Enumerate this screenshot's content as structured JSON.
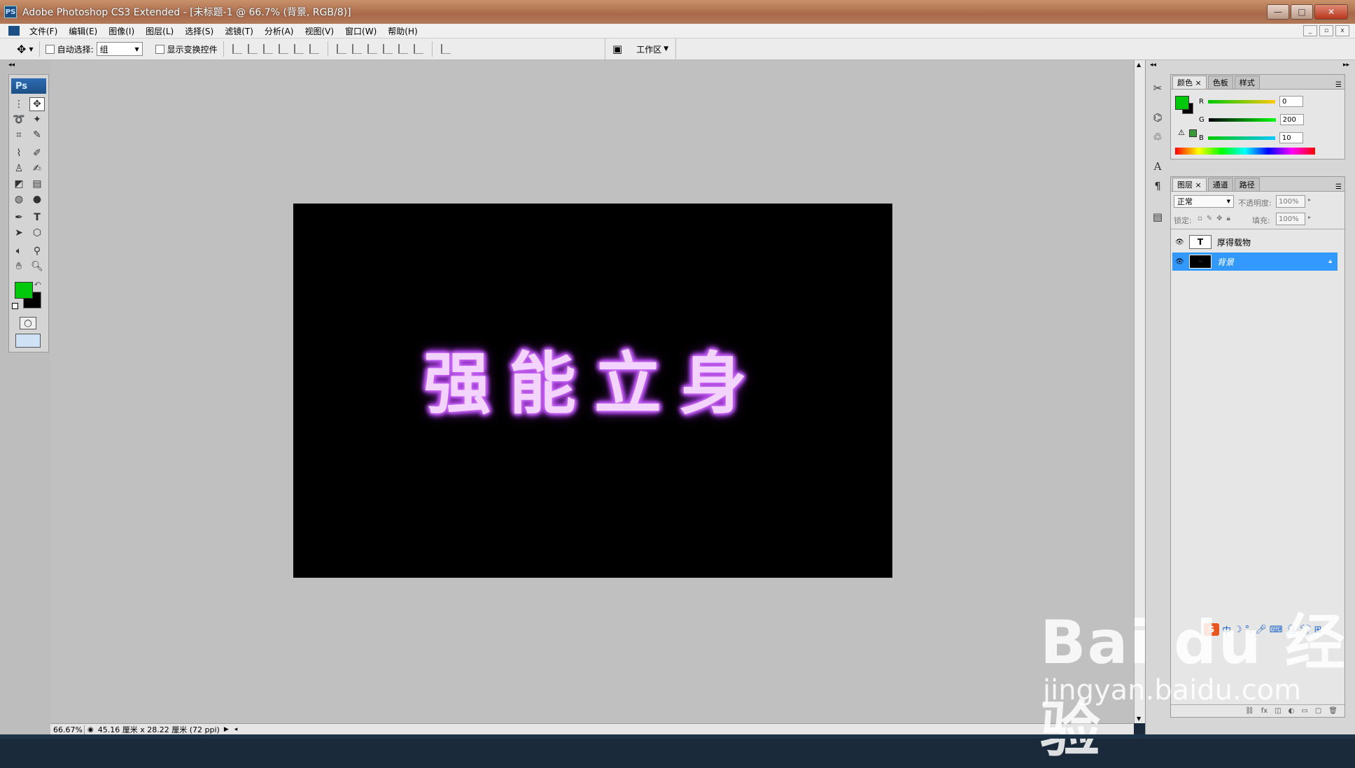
{
  "window": {
    "app_icon": "PS",
    "title": "Adobe Photoshop CS3 Extended - [未标题-1 @ 66.7% (背景, RGB/8)]",
    "min": "—",
    "max": "□",
    "close": "✕"
  },
  "menu": [
    "文件(F)",
    "编辑(E)",
    "图像(I)",
    "图层(L)",
    "选择(S)",
    "滤镜(T)",
    "分析(A)",
    "视图(V)",
    "窗口(W)",
    "帮助(H)"
  ],
  "options": {
    "auto_select_label": "自动选择:",
    "auto_select_value": "组",
    "show_transform_label": "显示变换控件",
    "workspace_label": "工作区"
  },
  "toolbox": {
    "logo": "Ps"
  },
  "canvas": {
    "text": "强能立身"
  },
  "status": {
    "zoom": "66.67%",
    "doc_info": "45.16 厘米 x 28.22 厘米 (72 ppi)"
  },
  "color_panel": {
    "tabs": [
      "颜色",
      "色板",
      "样式"
    ],
    "r_label": "R",
    "g_label": "G",
    "b_label": "B",
    "r_value": "0",
    "g_value": "200",
    "b_value": "10",
    "foreground": "#00c80a",
    "background": "#000000"
  },
  "layers_panel": {
    "tabs": [
      "图层",
      "通道",
      "路径"
    ],
    "blend_mode": "正常",
    "opacity_label": "不透明度:",
    "opacity_value": "100%",
    "lock_label": "锁定:",
    "fill_label": "填充:",
    "fill_value": "100%",
    "layers": [
      {
        "name": "厚得载物",
        "type": "text"
      },
      {
        "name": "背景",
        "type": "image",
        "selected": true
      }
    ]
  },
  "ime": {
    "logo": "S",
    "mode": "中"
  },
  "watermark": {
    "logo": "Bai du 经验",
    "url": "jingyan.baidu.com"
  }
}
